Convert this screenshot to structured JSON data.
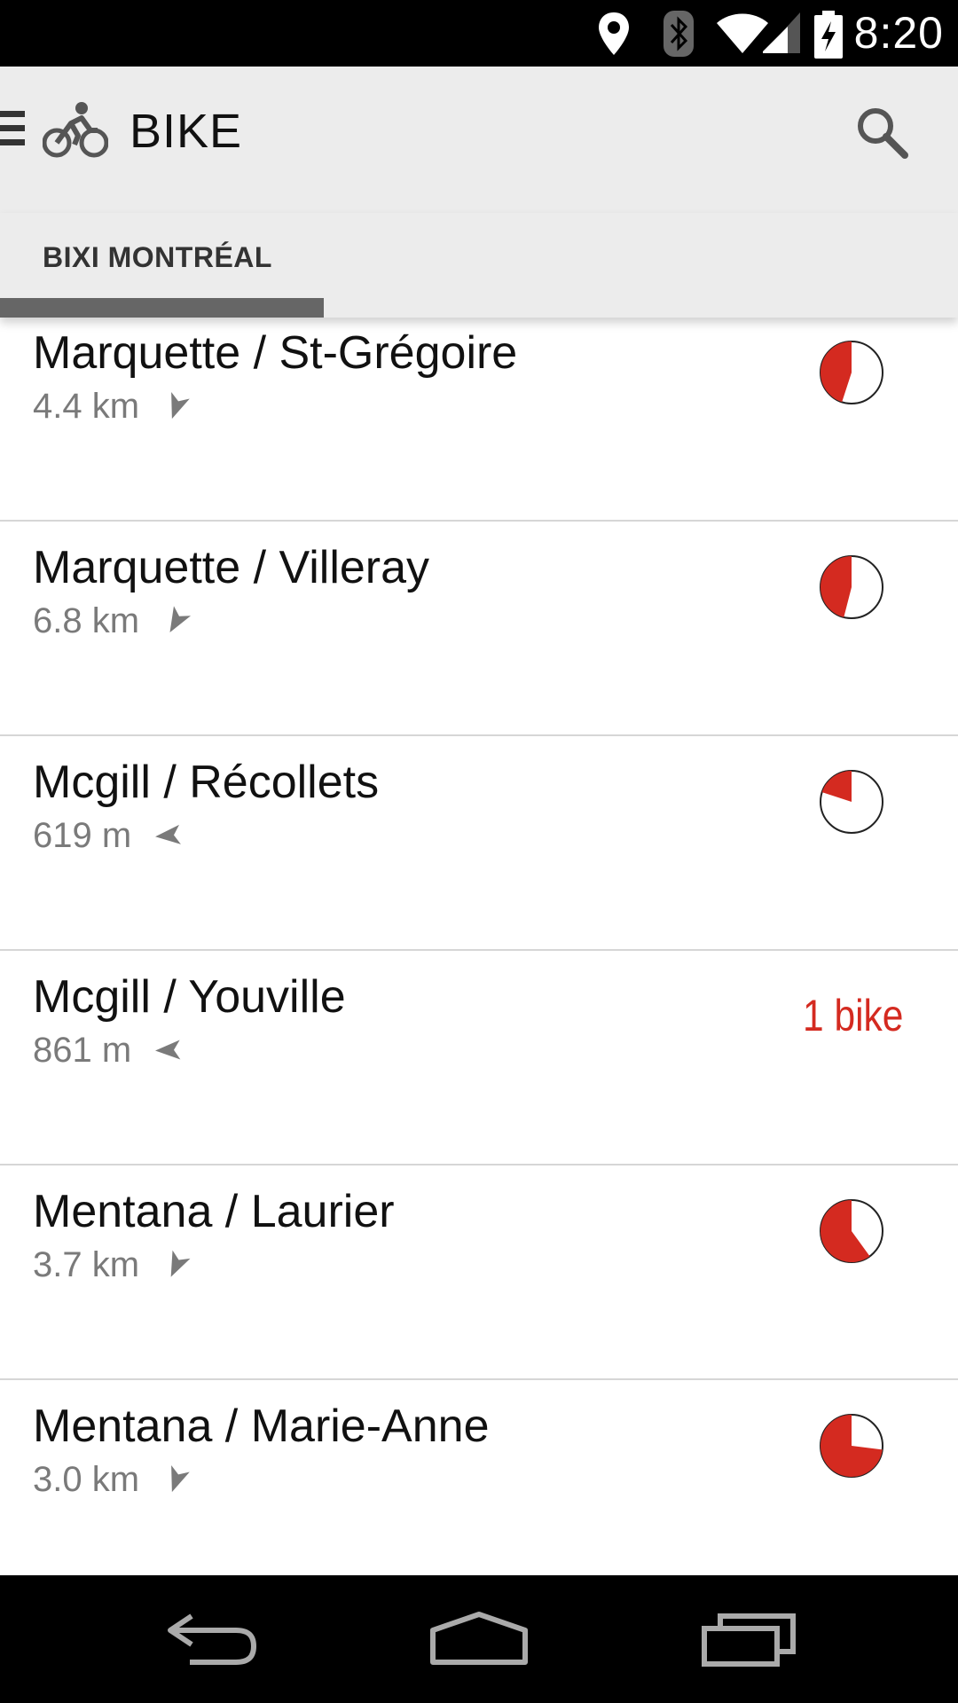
{
  "status_bar": {
    "time": "8:20",
    "icons": [
      "location-icon",
      "bluetooth-icon",
      "wifi-icon",
      "signal-icon",
      "battery-charging-icon"
    ]
  },
  "app_bar": {
    "title": "BIKE",
    "logo_icon": "bike-icon",
    "menu_icon": "menu-icon",
    "search_icon": "search-icon"
  },
  "tabs": [
    {
      "label": "BIXI MONTRÉAL",
      "selected": true
    }
  ],
  "colors": {
    "accent": "#d42a20",
    "app_bar_bg": "#ececec",
    "tab_indicator": "#666666"
  },
  "stations": [
    {
      "name": "Marquette / St-Grégoire",
      "distance": "4.4 km",
      "direction_deg": 200,
      "availability_type": "pie",
      "fill_fraction": 0.45
    },
    {
      "name": "Marquette / Villeray",
      "distance": "6.8 km",
      "direction_deg": 210,
      "availability_type": "pie",
      "fill_fraction": 0.46
    },
    {
      "name": "Mcgill / Récollets",
      "distance": "619 m",
      "direction_deg": 265,
      "availability_type": "pie",
      "fill_fraction": 0.2
    },
    {
      "name": "Mcgill / Youville",
      "distance": "861 m",
      "direction_deg": 268,
      "availability_type": "text",
      "availability_text": "1 bike"
    },
    {
      "name": "Mentana / Laurier",
      "distance": "3.7 km",
      "direction_deg": 205,
      "availability_type": "pie",
      "fill_fraction": 0.6
    },
    {
      "name": "Mentana / Marie-Anne",
      "distance": "3.0 km",
      "direction_deg": 200,
      "availability_type": "pie",
      "fill_fraction": 0.73
    }
  ],
  "nav_bar": {
    "buttons": [
      "back-icon",
      "home-icon",
      "recents-icon"
    ]
  }
}
